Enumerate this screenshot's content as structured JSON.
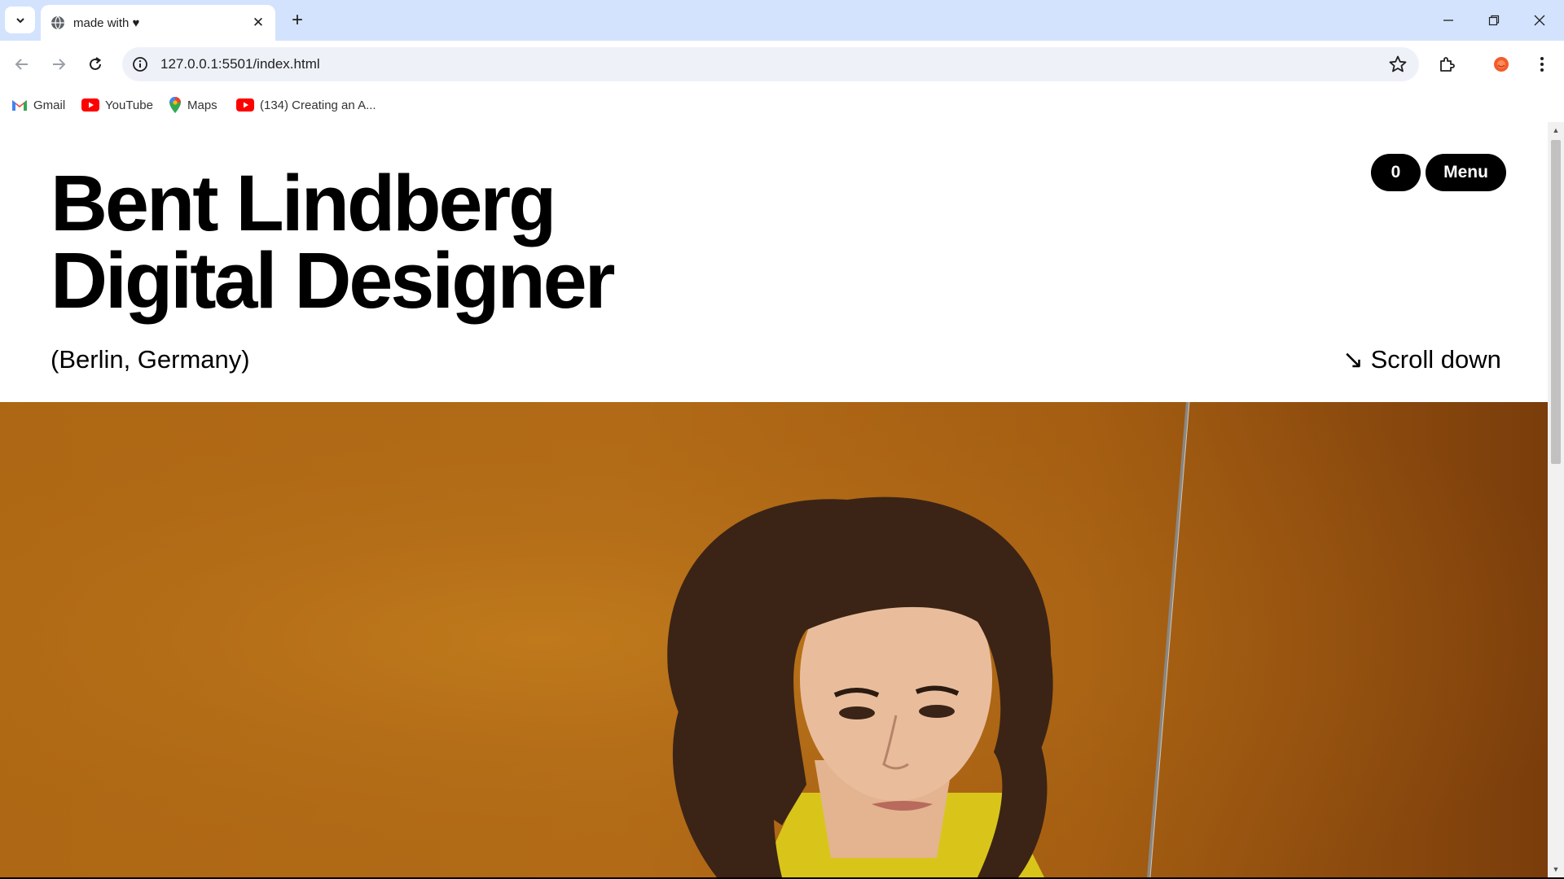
{
  "browser": {
    "tab_title": "made with ♥",
    "url": "127.0.0.1:5501/index.html",
    "bookmarks": [
      {
        "label": "Gmail",
        "icon": "gmail-icon"
      },
      {
        "label": "YouTube",
        "icon": "youtube-icon"
      },
      {
        "label": "Maps",
        "icon": "maps-icon"
      },
      {
        "label": "(134) Creating an A...",
        "icon": "youtube-icon"
      }
    ]
  },
  "site": {
    "title_line1": "Bent Lindberg",
    "title_line2": "Digital Designer",
    "location": "(Berlin, Germany)",
    "scroll_hint": "Scroll down",
    "scroll_arrow": "↘",
    "cart_count": "0",
    "menu_label": "Menu"
  },
  "colors": {
    "tabbar": "#d3e3fd",
    "omnibox": "#eef1f8",
    "hero_bg": "#b06914",
    "pill_bg": "#000000"
  }
}
